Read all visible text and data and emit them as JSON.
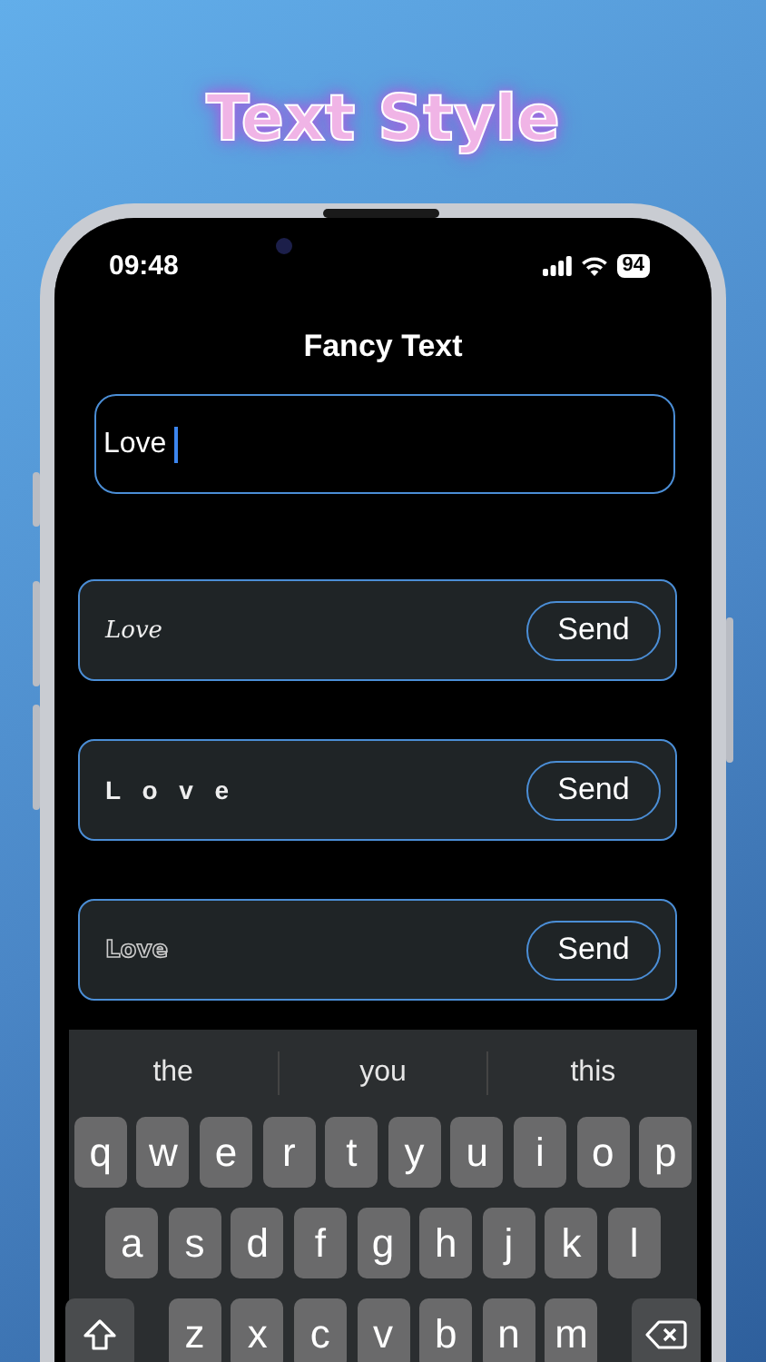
{
  "headline": "Text Style",
  "status_bar": {
    "time": "09:48",
    "battery": "94"
  },
  "title": "Fancy Text",
  "input": {
    "value": "Love",
    "focused": true
  },
  "results": [
    {
      "text": "Love",
      "kind": "script",
      "button": "Send"
    },
    {
      "text": "L o v e",
      "kind": "spaced",
      "button": "Send"
    },
    {
      "text": "Love",
      "kind": "outline",
      "button": "Send"
    }
  ],
  "keyboard": {
    "suggestions": [
      "the",
      "you",
      "this"
    ],
    "rows": [
      [
        "q",
        "w",
        "e",
        "r",
        "t",
        "y",
        "u",
        "i",
        "o",
        "p"
      ],
      [
        "a",
        "s",
        "d",
        "f",
        "g",
        "h",
        "j",
        "k",
        "l"
      ],
      [
        "z",
        "x",
        "c",
        "v",
        "b",
        "n",
        "m"
      ]
    ]
  }
}
